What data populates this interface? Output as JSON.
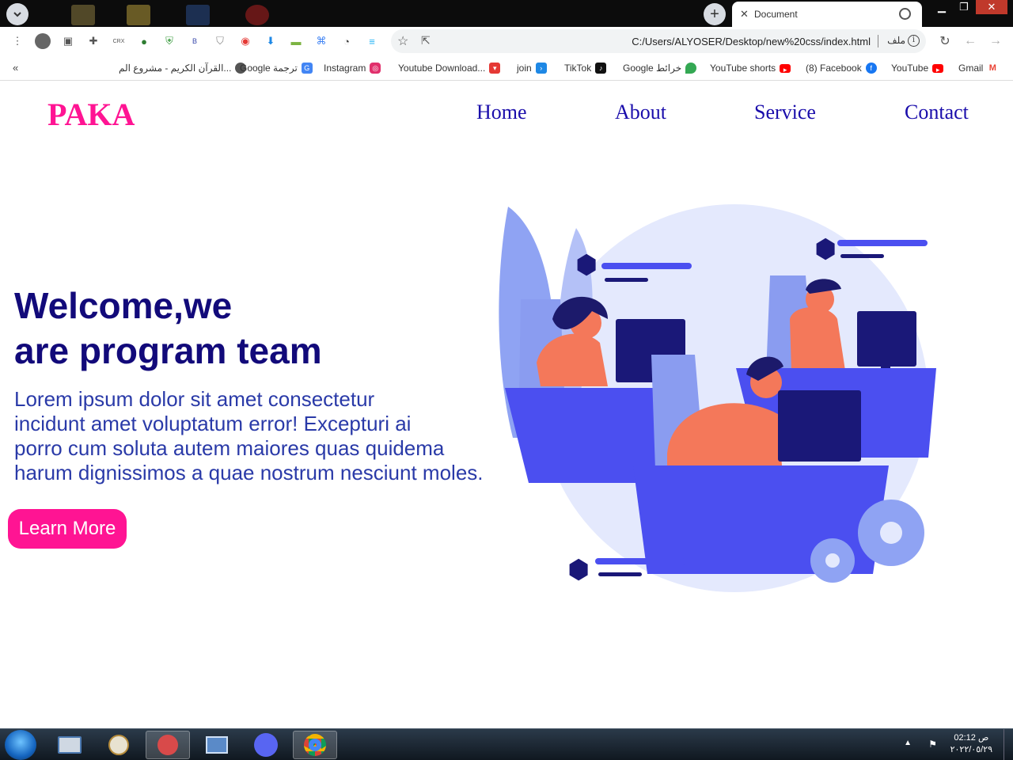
{
  "browser": {
    "tab_title": "Document",
    "url": "C:/Users/ALYOSER/Desktop/new%20css/index.html",
    "site_label": "ملف",
    "bookmarks": [
      {
        "label": "القرآن الكريم - مشروع الم...",
        "icon": "globe-icon",
        "color": "#555555"
      },
      {
        "label": "Google ترجمة",
        "icon": "google-translate-icon",
        "color": "#4285f4"
      },
      {
        "label": "Instagram",
        "icon": "instagram-icon",
        "color": "#e1306c"
      },
      {
        "label": "Youtube Download...",
        "icon": "download-icon",
        "color": "#e53935"
      },
      {
        "label": "join",
        "icon": "vscode-icon",
        "color": "#1e88e5"
      },
      {
        "label": "TikTok",
        "icon": "tiktok-icon",
        "color": "#111111"
      },
      {
        "label": "Google خرائط",
        "icon": "maps-icon",
        "color": "#34a853"
      },
      {
        "label": "YouTube shorts",
        "icon": "youtube-icon",
        "color": "#ff0000"
      },
      {
        "label": "(8) Facebook",
        "icon": "facebook-icon",
        "color": "#1877f2"
      },
      {
        "label": "YouTube",
        "icon": "youtube-icon",
        "color": "#ff0000"
      },
      {
        "label": "Gmail",
        "icon": "gmail-icon",
        "color": "#ea4335"
      }
    ]
  },
  "page": {
    "logo": "PAKA",
    "nav": [
      "Home",
      "About",
      "Service",
      "Contact"
    ],
    "hero": {
      "title_lines": [
        "Welcome,we",
        "are program team"
      ],
      "text_lines": [
        "Lorem ipsum dolor sit amet consectetur",
        "incidunt amet voluptatum error! Excepturi ai",
        "porro cum soluta autem maiores quas quidema",
        "harum dignissimos a quae nostrum nesciunt moles."
      ],
      "button": "Learn More"
    },
    "colors": {
      "logo": "#ff1493",
      "nav": "#1a0dab",
      "title": "#120a7a",
      "text": "#2a3aa8",
      "button_bg": "#ff1493",
      "illustration_primary": "#4b4ff0",
      "illustration_accent": "#f4785a"
    }
  },
  "taskbar": {
    "time": "02:12 ص",
    "date": "٢٠٢٢/٠٥/٢٩"
  }
}
